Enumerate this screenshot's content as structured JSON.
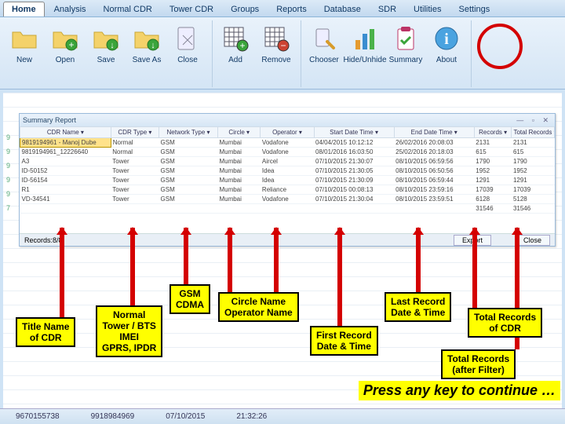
{
  "tabs": [
    "Home",
    "Analysis",
    "Normal CDR",
    "Tower CDR",
    "Groups",
    "Reports",
    "Database",
    "SDR",
    "Utilities",
    "Settings"
  ],
  "active_tab_index": 0,
  "ribbon": {
    "file": [
      {
        "name": "new",
        "label": "New",
        "icon": "folder"
      },
      {
        "name": "open",
        "label": "Open",
        "icon": "folder-plus"
      },
      {
        "name": "save",
        "label": "Save",
        "icon": "folder-down"
      },
      {
        "name": "saveas",
        "label": "Save As",
        "icon": "folder-down"
      },
      {
        "name": "close",
        "label": "Close",
        "icon": "close"
      }
    ],
    "edit": [
      {
        "name": "add",
        "label": "Add",
        "icon": "grid-plus"
      },
      {
        "name": "remove",
        "label": "Remove",
        "icon": "grid-minus"
      }
    ],
    "view": [
      {
        "name": "chooser",
        "label": "Chooser",
        "icon": "wrench"
      },
      {
        "name": "hide",
        "label": "Hide/Unhide",
        "icon": "bars"
      },
      {
        "name": "summary",
        "label": "Summary",
        "icon": "clipboard"
      },
      {
        "name": "about",
        "label": "About",
        "icon": "info"
      }
    ]
  },
  "report": {
    "title": "Summary Report",
    "records_label": "Records:8/8",
    "export_label": "Export",
    "close_label": "Close",
    "columns": [
      "CDR Name",
      "CDR Type",
      "Network Type",
      "Circle",
      "Operator",
      "Start Date Time",
      "End Date Time",
      "Records",
      "Total Records"
    ],
    "rows": [
      {
        "name": "9819194961 - Manoj Dube",
        "type": "Normal",
        "net": "GSM",
        "circle": "Mumbai",
        "op": "Vodafone",
        "start": "04/04/2015 10:12:12",
        "end": "26/02/2016 20:08:03",
        "rec": "2131",
        "tot": "2131"
      },
      {
        "name": "9819194961_12226640",
        "type": "Normal",
        "net": "GSM",
        "circle": "Mumbai",
        "op": "Vodafone",
        "start": "08/01/2016 16:03:50",
        "end": "25/02/2016 20:18:03",
        "rec": "615",
        "tot": "615"
      },
      {
        "name": "A3",
        "type": "Tower",
        "net": "GSM",
        "circle": "Mumbai",
        "op": "Aircel",
        "start": "07/10/2015 21:30:07",
        "end": "08/10/2015 06:59:56",
        "rec": "1790",
        "tot": "1790"
      },
      {
        "name": "ID-50152",
        "type": "Tower",
        "net": "GSM",
        "circle": "Mumbai",
        "op": "Idea",
        "start": "07/10/2015 21:30:05",
        "end": "08/10/2015 06:50:56",
        "rec": "1952",
        "tot": "1952"
      },
      {
        "name": "ID-56154",
        "type": "Tower",
        "net": "GSM",
        "circle": "Mumbai",
        "op": "Idea",
        "start": "07/10/2015 21:30:09",
        "end": "08/10/2015 06:59:44",
        "rec": "1291",
        "tot": "1291"
      },
      {
        "name": "R1",
        "type": "Tower",
        "net": "GSM",
        "circle": "Mumbai",
        "op": "Reliance",
        "start": "07/10/2015 00:08:13",
        "end": "08/10/2015 23:59:16",
        "rec": "17039",
        "tot": "17039"
      },
      {
        "name": "VD-34541",
        "type": "Tower",
        "net": "GSM",
        "circle": "Mumbai",
        "op": "Vodafone",
        "start": "07/10/2015 21:30:04",
        "end": "08/10/2015 23:59:51",
        "rec": "6128",
        "tot": "5128"
      },
      {
        "name": "",
        "type": "",
        "net": "",
        "circle": "",
        "op": "",
        "start": "",
        "end": "",
        "rec": "31546",
        "tot": "31546"
      }
    ]
  },
  "callouts": {
    "title_name": "Title Name\nof CDR",
    "cdr_type": "Normal\nTower / BTS\nIMEI\nGPRS, IPDR",
    "network": "GSM\nCDMA",
    "circle_op": "Circle Name\nOperator Name",
    "first_dt": "First Record\nDate & Time",
    "last_dt": "Last Record\nDate & Time",
    "total": "Total Records\nof CDR",
    "total_filter": "Total Records\n(after Filter)"
  },
  "continue_text": "Press any key to continue …",
  "footer": {
    "a": "9670155738",
    "b": "9918984969",
    "c": "07/10/2015",
    "d": "21:32:26"
  },
  "left_numbers": [
    "9",
    "9",
    "9",
    "9",
    "9",
    "7"
  ]
}
